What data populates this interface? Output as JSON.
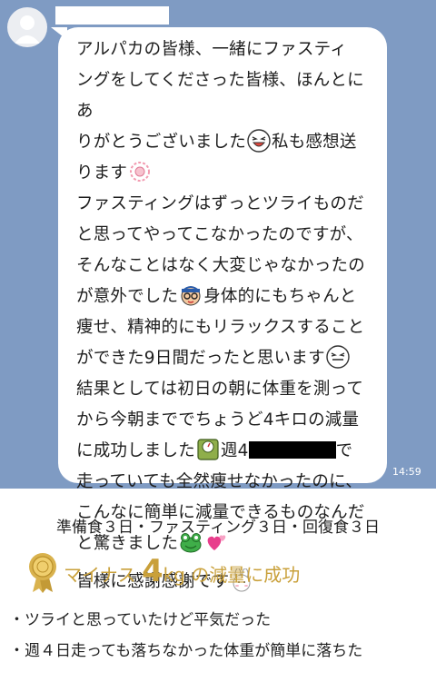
{
  "chat": {
    "background_color": "#7f9bc3",
    "message": {
      "lines": [
        "アルパカの皆様、一緒にファスティ",
        "ングをしてくださった皆様、ほんとにあ",
        "りがとうございました",
        "私も感想送",
        "ります",
        "ファスティングはずっとツライものだ",
        "と思ってやってこなかったのですが、",
        "そんなことはなく大変じゃなかったの",
        "が意外でした",
        "身体的にもちゃんと",
        "痩せ、精神的にもリラックスすること",
        "ができた9日間だったと思います",
        "結果としては初日の朝に体重を測って",
        "から今朝まででちょうど4キロの減量",
        "に成功しました",
        "週4",
        "で",
        "走っていても全然痩せなかったのに、",
        "こんなに簡単に減量できるものなんだ",
        "と驚きました",
        "皆様に感謝感謝です"
      ],
      "emoji": [
        "laughing-face",
        "pink-blossom",
        "boy-with-glasses",
        "grinning-face",
        "weighing-scale",
        "frog",
        "pink-hearts",
        "bunny"
      ]
    },
    "timestamp": "14:59"
  },
  "summary": {
    "schedule": "準備食３日・ファスティング３日・回復食３日",
    "result": {
      "prefix": "マイナス",
      "number": "4",
      "unit": "kg",
      "suffix": "の減量に成功",
      "accent_color": "#c9a03a",
      "icon": "gold-medal"
    },
    "bullets": [
      "・ツライと思っていたけど平気だった",
      "・週４日走っても落ちなかった体重が簡単に落ちた"
    ]
  }
}
